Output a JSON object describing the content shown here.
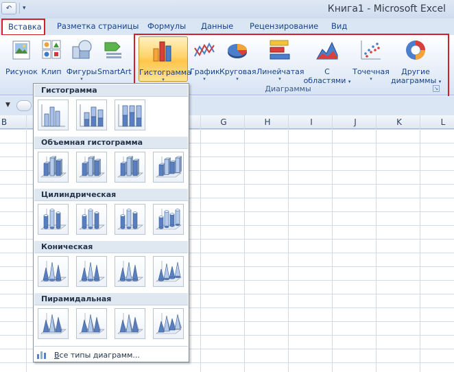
{
  "window": {
    "title": "Книга1 - Microsoft Excel",
    "qat_more_glyph": "▾"
  },
  "tabs": [
    {
      "label": "Вставка",
      "active": true
    },
    {
      "label": "Разметка страницы"
    },
    {
      "label": "Формулы"
    },
    {
      "label": "Данные"
    },
    {
      "label": "Рецензирование"
    },
    {
      "label": "Вид"
    }
  ],
  "ribbon": {
    "buttons": [
      {
        "label": "Рисунок",
        "icon": "picture-icon"
      },
      {
        "label": "Клип",
        "icon": "clipart-icon"
      },
      {
        "label": "Фигуры",
        "icon": "shapes-icon",
        "dropdown": true
      },
      {
        "label": "SmartArt",
        "icon": "smartart-icon"
      },
      {
        "label": "Гистограмма",
        "icon": "column-chart-icon",
        "dropdown": true,
        "active": true
      },
      {
        "label": "График",
        "icon": "line-chart-icon",
        "dropdown": true
      },
      {
        "label": "Круговая",
        "icon": "pie-chart-icon",
        "dropdown": true
      },
      {
        "label": "Линейчатая",
        "icon": "bar-chart-icon",
        "dropdown": true
      },
      {
        "label": "С",
        "label2": "областями",
        "icon": "area-chart-icon",
        "dropdown": true
      },
      {
        "label": "Точечная",
        "icon": "scatter-chart-icon",
        "dropdown": true
      },
      {
        "label": "Другие",
        "label2": "диаграммы",
        "icon": "other-charts-icon",
        "dropdown": true
      }
    ],
    "group_label": "Диаграммы",
    "dropdown_glyph": "▾"
  },
  "grid": {
    "columns": [
      "B",
      "G",
      "H",
      "I",
      "J",
      "K",
      "L"
    ]
  },
  "gallery": {
    "sections": [
      {
        "title": "Гистограмма",
        "items": [
          "clustered-column-icon",
          "stacked-column-icon",
          "100-stacked-column-icon"
        ]
      },
      {
        "title": "Объемная гистограмма",
        "items": [
          "3d-clustered-column-icon",
          "3d-stacked-column-icon",
          "3d-100-stacked-column-icon",
          "3d-column-icon"
        ]
      },
      {
        "title": "Цилиндрическая",
        "items": [
          "clustered-cylinder-icon",
          "stacked-cylinder-icon",
          "100-stacked-cylinder-icon",
          "3d-cylinder-icon"
        ]
      },
      {
        "title": "Коническая",
        "items": [
          "clustered-cone-icon",
          "stacked-cone-icon",
          "100-stacked-cone-icon",
          "3d-cone-icon"
        ]
      },
      {
        "title": "Пирамидальная",
        "items": [
          "clustered-pyramid-icon",
          "stacked-pyramid-icon",
          "100-stacked-pyramid-icon",
          "3d-pyramid-icon"
        ]
      }
    ],
    "all_types_label": "Все типы диаграмм...",
    "all_types_accelerator": "В"
  },
  "colors": {
    "highlight_red": "#d01f2b",
    "active_button": "#ffc54a",
    "bar_blue": "#5a7fc0"
  }
}
